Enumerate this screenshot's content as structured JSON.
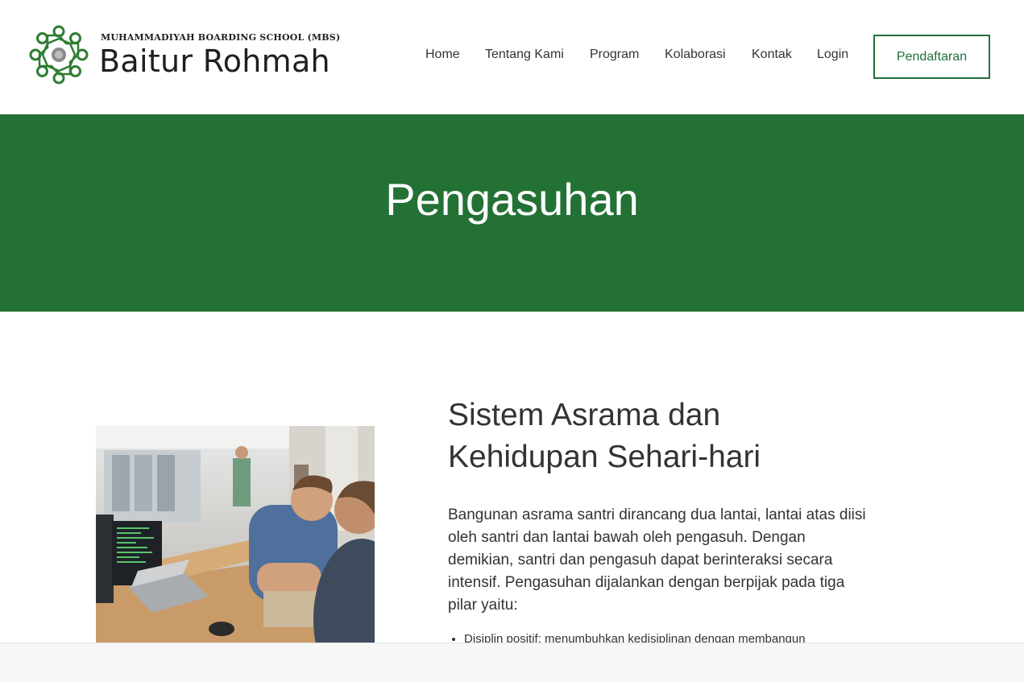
{
  "brand": {
    "subtitle": "MUHAMMADIYAH BOARDING SCHOOL (MBS)",
    "name": "Baitur Rohmah",
    "color": "#237135"
  },
  "nav": {
    "items": [
      "Home",
      "Tentang Kami",
      "Program",
      "Kolaborasi",
      "Kontak",
      "Login"
    ],
    "cta": "Pendaftaran"
  },
  "hero": {
    "title": "Pengasuhan"
  },
  "main": {
    "heading": "Sistem Asrama dan Kehidupan Sehari-hari",
    "paragraph": "Bangunan asrama santri dirancang dua lantai, lantai atas diisi oleh santri dan lantai bawah oleh pengasuh. Dengan demikian, santri dan pengasuh dapat berinteraksi secara intensif. Pengasuhan dijalankan dengan berpijak pada tiga pilar yaitu:",
    "bullets": [
      "Disiplin positif: menumbuhkan kedisiplinan dengan membangun"
    ]
  }
}
